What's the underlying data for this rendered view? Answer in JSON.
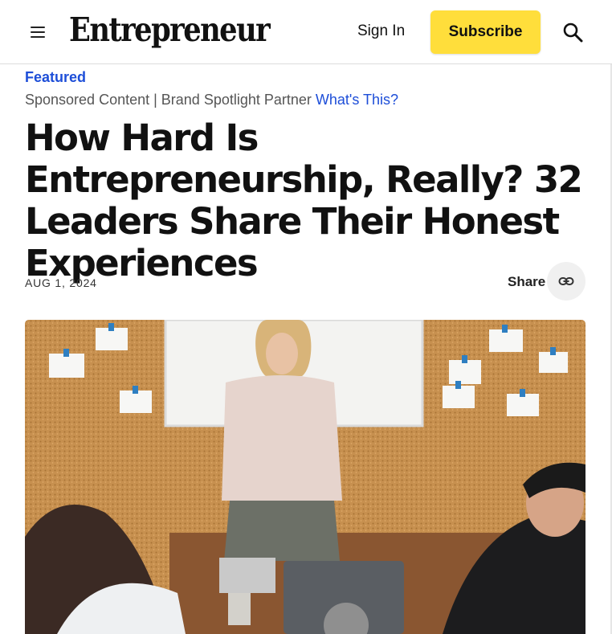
{
  "header": {
    "logo": "Entrepreneur",
    "sign_in": "Sign In",
    "subscribe": "Subscribe",
    "menu_icon": "hamburger-menu-icon",
    "search_icon": "search-icon"
  },
  "article": {
    "kicker": "Featured",
    "sponsor_text": "Sponsored Content | Brand Spotlight Partner",
    "sponsor_link": "What's This?",
    "headline": "How Hard Is Entrepreneurship, Really? 32 Leaders Share Their Honest Experiences",
    "date": "AUG 1, 2024",
    "share_label": "Share",
    "share_icon": "link-icon"
  },
  "colors": {
    "accent_blue": "#1d4ed8",
    "subscribe_yellow": "#ffde3b",
    "cork": "#c7904f"
  }
}
